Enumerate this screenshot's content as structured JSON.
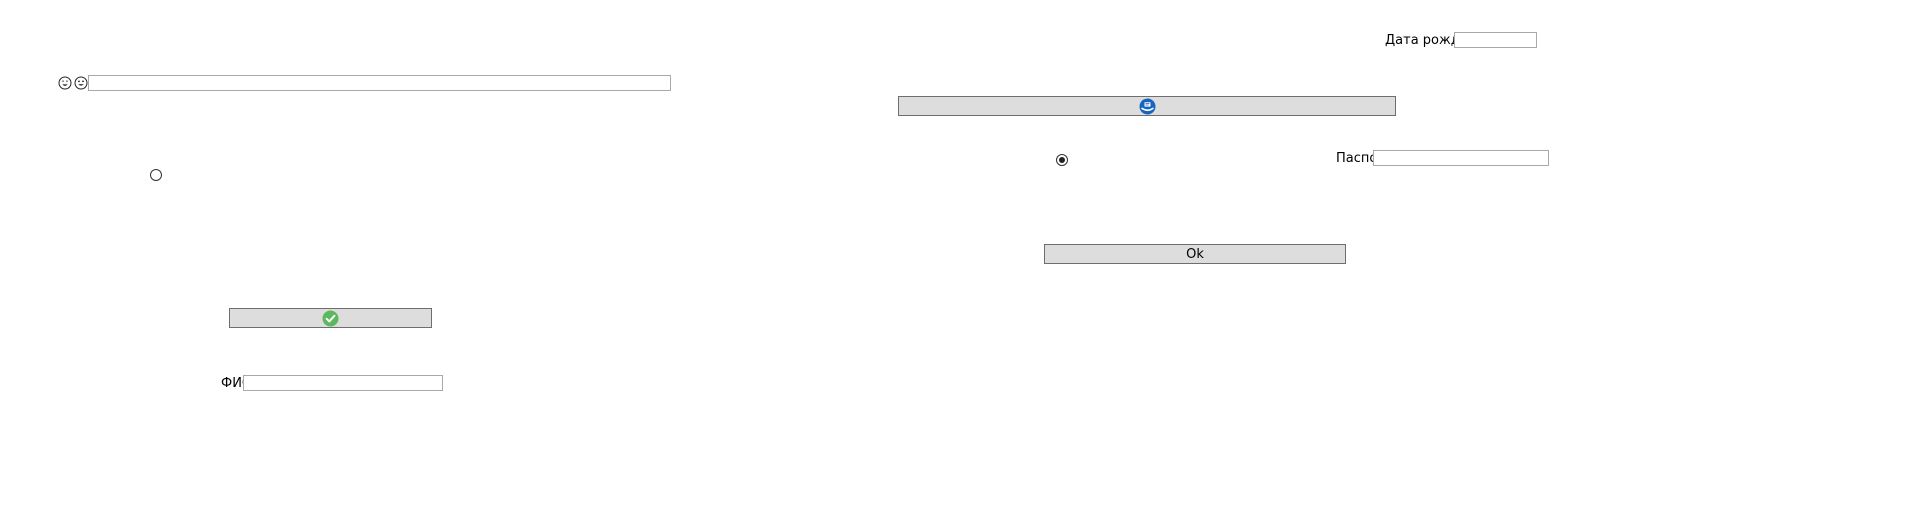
{
  "form": {
    "birthdate": {
      "label": "Дата рождения",
      "value": ""
    },
    "passport": {
      "label": "Паспорт",
      "value": ""
    },
    "fio": {
      "label": "ФИО",
      "value": ""
    },
    "top_input": {
      "value": ""
    },
    "ok_button": {
      "label": "Ok"
    },
    "radio_left": {
      "checked": false
    },
    "radio_right": {
      "checked": true
    }
  },
  "icons": {
    "emoji_1": "grinning-sweat-face-icon",
    "emoji_2": "grinning-face-icon",
    "check_button_icon": "green-checkmark-icon",
    "blue_button_icon": "blue-circle-badge-icon"
  },
  "colors": {
    "button_bg": "#dddddd",
    "button_border": "#6e6e6e",
    "input_border": "#a9a9a9",
    "check_green": "#5cb85c",
    "badge_blue": "#1565c0"
  }
}
